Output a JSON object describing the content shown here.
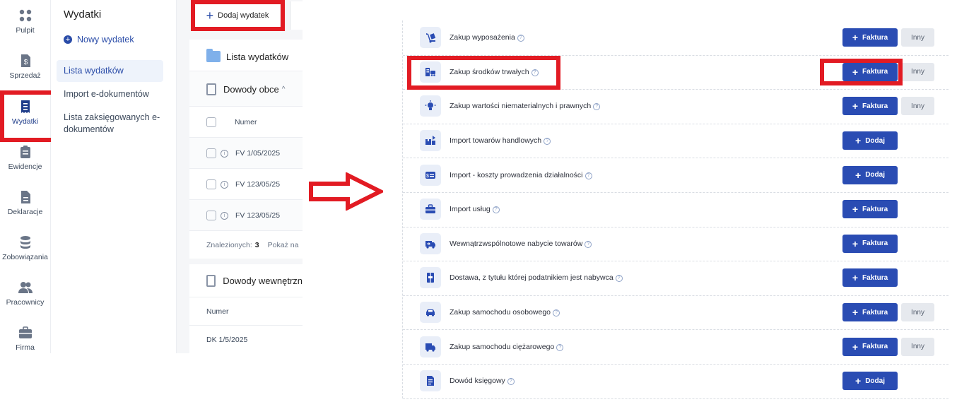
{
  "left_panel": {
    "rail": [
      {
        "label": "Pulpit",
        "icon": "dashboard-icon"
      },
      {
        "label": "Sprzedaż",
        "icon": "invoice-dollar-icon"
      },
      {
        "label": "Wydatki",
        "icon": "receipt-icon"
      },
      {
        "label": "Ewidencje",
        "icon": "clipboard-icon"
      },
      {
        "label": "Deklaracje",
        "icon": "document-icon"
      },
      {
        "label": "Zobowiązania",
        "icon": "coins-icon"
      },
      {
        "label": "Pracownicy",
        "icon": "users-icon"
      },
      {
        "label": "Firma",
        "icon": "briefcase-icon"
      }
    ],
    "active_rail_item": "Wydatki",
    "submenu": {
      "title": "Wydatki",
      "new_expense": "Nowy wydatek",
      "links": [
        "Lista wydatków",
        "Import e-dokumentów",
        "Lista zaksięgowanych e-dokumentów"
      ]
    },
    "add_button": "Dodaj wydatek",
    "list_title": "Lista wydatków",
    "section_external": "Dowody obce",
    "column_number": "Numer",
    "rows": [
      "FV 1/05/2025",
      "FV 123/05/25",
      "FV 123/05/25"
    ],
    "found_label": "Znalezionych:",
    "found_count": "3",
    "show_label": "Pokaż na",
    "section_internal": "Dowody wewnętrzn",
    "internal_column": "Numer",
    "internal_rows": [
      "DK 1/5/2025"
    ]
  },
  "right_panel": {
    "items": [
      {
        "label": "Zakup wyposażenia",
        "button": "Faktura",
        "other": "Inny",
        "icon": "dolly-icon"
      },
      {
        "label": "Zakup środków trwałych",
        "button": "Faktura",
        "other": "Inny",
        "icon": "fixed-assets-icon"
      },
      {
        "label": "Zakup wartości niematerialnych i prawnych",
        "button": "Faktura",
        "other": "Inny",
        "icon": "lightbulb-icon"
      },
      {
        "label": "Import towarów handlowych",
        "button": "Dodaj",
        "other": null,
        "icon": "boxes-import-icon"
      },
      {
        "label": "Import - koszty prowadzenia działalności",
        "button": "Dodaj",
        "other": null,
        "icon": "money-list-icon"
      },
      {
        "label": "Import usług",
        "button": "Faktura",
        "other": null,
        "icon": "toolbox-icon"
      },
      {
        "label": "Wewnątrzwspólnotowe nabycie towarów",
        "button": "Faktura",
        "other": null,
        "icon": "truck-arrow-icon"
      },
      {
        "label": "Dostawa, z tytułu której podatnikiem jest nabywca",
        "button": "Faktura",
        "other": null,
        "icon": "package-icon"
      },
      {
        "label": "Zakup samochodu osobowego",
        "button": "Faktura",
        "other": "Inny",
        "icon": "car-icon"
      },
      {
        "label": "Zakup samochodu ciężarowego",
        "button": "Faktura",
        "other": "Inny",
        "icon": "truck-icon"
      },
      {
        "label": "Dowód księgowy",
        "button": "Dodaj",
        "other": null,
        "icon": "document-lines-icon"
      }
    ]
  },
  "colors": {
    "accent": "#2a4cb3",
    "highlight": "#e21b23",
    "secondary_button": "#e6e9ee",
    "icon_bg": "#e9eef8"
  }
}
